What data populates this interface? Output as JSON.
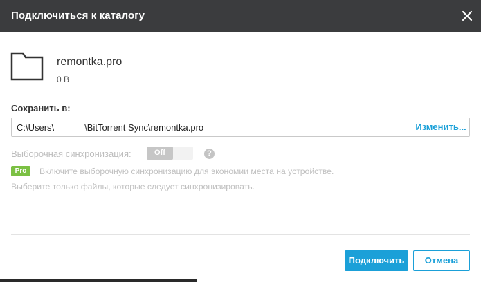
{
  "dialog": {
    "title": "Подключиться к каталогу",
    "close_icon": "close-icon"
  },
  "folder": {
    "icon": "folder-icon",
    "name": "remontka.pro",
    "size": "0 B"
  },
  "save_to": {
    "label": "Сохранить в:",
    "path_prefix": "C:\\Users\\",
    "path_suffix": "\\BitTorrent Sync\\remontka.pro",
    "change_label": "Изменить..."
  },
  "selective_sync": {
    "label": "Выборочная синхронизация:",
    "toggle_label": "Off",
    "help_icon": "help-icon",
    "help_glyph": "?",
    "pro_badge": "Pro",
    "pro_text_line1": "Включите выборочную синхронизацию для экономии места на устройстве.",
    "pro_text_line2": "Выберите только файлы, которые следует синхронизировать."
  },
  "buttons": {
    "connect_label": "Подключить",
    "cancel_label": "Отмена"
  },
  "colors": {
    "titlebar": "#3b3c3e",
    "accent": "#1ba0d8",
    "pro_badge": "#7bc043",
    "disabled_text": "#c0c0c0"
  }
}
